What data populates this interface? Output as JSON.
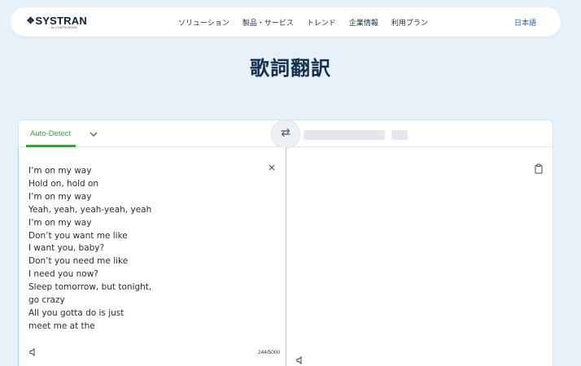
{
  "brand": {
    "name": "SYSTRAN",
    "glyph": "✥",
    "sub": "by CHAPSVISION"
  },
  "nav": {
    "items": [
      {
        "label": "ソリューション"
      },
      {
        "label": "製品・サービス"
      },
      {
        "label": "トレンド"
      },
      {
        "label": "企業情報"
      },
      {
        "label": "利用プラン"
      }
    ],
    "language": "日本語"
  },
  "page": {
    "title": "歌詞翻訳"
  },
  "translator": {
    "source_language": "Auto-Detect",
    "source_text": "I’m on my way\nHold on, hold on\nI’m on my way\nYeah, yeah, yeah-yeah, yeah\nI’m on my way\nDon’t you want me like\nI want you, baby?\nDon’t you need me like\nI need you now?\nSleep tomorrow, but tonight,\ngo crazy\nAll you gotta do is just\nmeet me at the",
    "char_count": "244/5000",
    "accent_color": "#3aa13a",
    "icons": {
      "dropdown": "chevron-down-icon",
      "swap": "swap-icon",
      "clear": "close-icon",
      "speaker": "speaker-icon",
      "copy": "clipboard-icon"
    }
  }
}
